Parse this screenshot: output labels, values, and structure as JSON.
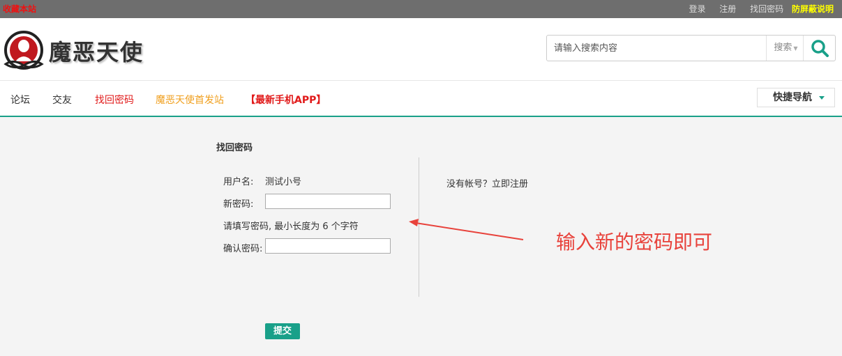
{
  "topbar": {
    "favorite": "收藏本站",
    "links": [
      "登录",
      "注册",
      "找回密码"
    ],
    "highlight": "防屏蔽说明"
  },
  "header": {
    "brand": "魔恶天使",
    "search": {
      "placeholder": "请输入搜索内容",
      "type_label": "搜索"
    }
  },
  "nav": {
    "items": [
      {
        "label": "论坛",
        "color": "#333333"
      },
      {
        "label": "交友",
        "color": "#333333"
      },
      {
        "label": "找回密码",
        "color": "#e11a1a"
      },
      {
        "label": "魔恶天使首发站",
        "color": "#f0a020"
      },
      {
        "label": "【最新手机APP】",
        "color": "#e11a1a"
      }
    ],
    "quick_nav": "快捷导航"
  },
  "form": {
    "title": "找回密码",
    "username_label": "用户名:",
    "username_value": "测试小号",
    "new_password_label": "新密码:",
    "hint": "请填写密码, 最小长度为 6 个字符",
    "confirm_label": "确认密码:",
    "submit": "提交"
  },
  "sidebar": {
    "register_link": "没有帐号？立即注册"
  },
  "annotation": {
    "text": "输入新的密码即可"
  },
  "colors": {
    "accent": "#19a089",
    "annotation": "#e8423b",
    "topbar": "#6e6e6e"
  }
}
